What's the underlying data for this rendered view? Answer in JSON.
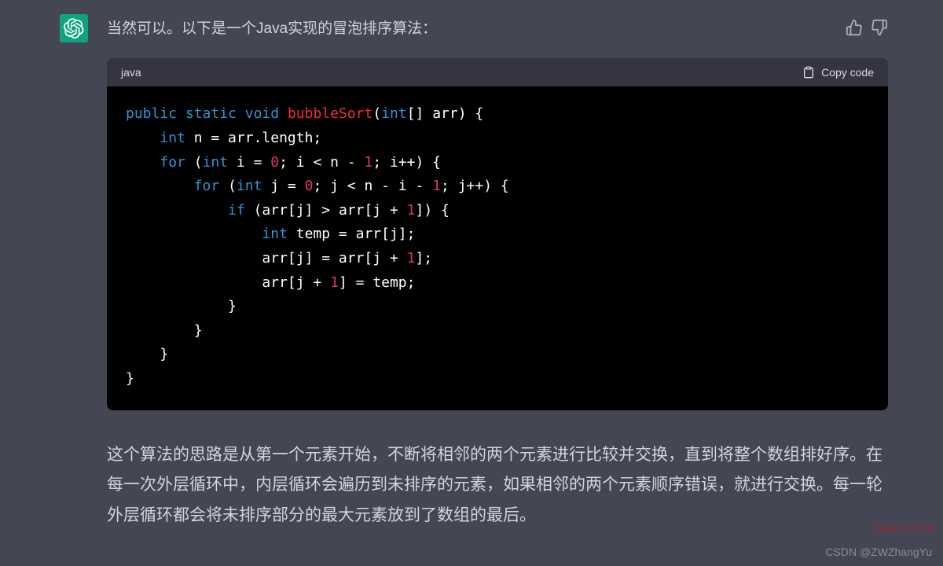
{
  "message": {
    "intro": "当然可以。以下是一个Java实现的冒泡排序算法：",
    "explanation": "这个算法的思路是从第一个元素开始，不断将相邻的两个元素进行比较并交换，直到将整个数组排好序。在每一次外层循环中，内层循环会遍历到未排序的元素，如果相邻的两个元素顺序错误，就进行交换。每一轮外层循环都会将未排序部分的最大元素放到了数组的最后。"
  },
  "code": {
    "language": "java",
    "copy_label": "Copy code",
    "tokens": [
      [
        {
          "t": "public",
          "c": "kw"
        },
        {
          "t": " "
        },
        {
          "t": "static",
          "c": "kw"
        },
        {
          "t": " "
        },
        {
          "t": "void",
          "c": "kw"
        },
        {
          "t": " "
        },
        {
          "t": "bubbleSort",
          "c": "fn"
        },
        {
          "t": "("
        },
        {
          "t": "int",
          "c": "type"
        },
        {
          "t": "[] arr) {"
        }
      ],
      [
        {
          "t": "    "
        },
        {
          "t": "int",
          "c": "type"
        },
        {
          "t": " n = arr.length;"
        }
      ],
      [
        {
          "t": "    "
        },
        {
          "t": "for",
          "c": "kw"
        },
        {
          "t": " ("
        },
        {
          "t": "int",
          "c": "type"
        },
        {
          "t": " i = "
        },
        {
          "t": "0",
          "c": "num"
        },
        {
          "t": "; i < n - "
        },
        {
          "t": "1",
          "c": "num"
        },
        {
          "t": "; i++) {"
        }
      ],
      [
        {
          "t": "        "
        },
        {
          "t": "for",
          "c": "kw"
        },
        {
          "t": " ("
        },
        {
          "t": "int",
          "c": "type"
        },
        {
          "t": " j = "
        },
        {
          "t": "0",
          "c": "num"
        },
        {
          "t": "; j < n - i - "
        },
        {
          "t": "1",
          "c": "num"
        },
        {
          "t": "; j++) {"
        }
      ],
      [
        {
          "t": "            "
        },
        {
          "t": "if",
          "c": "kw"
        },
        {
          "t": " (arr[j] > arr[j + "
        },
        {
          "t": "1",
          "c": "num"
        },
        {
          "t": "]) {"
        }
      ],
      [
        {
          "t": "                "
        },
        {
          "t": "int",
          "c": "type"
        },
        {
          "t": " temp = arr[j];"
        }
      ],
      [
        {
          "t": "                arr[j] = arr[j + "
        },
        {
          "t": "1",
          "c": "num"
        },
        {
          "t": "];"
        }
      ],
      [
        {
          "t": "                arr[j + "
        },
        {
          "t": "1",
          "c": "num"
        },
        {
          "t": "] = temp;"
        }
      ],
      [
        {
          "t": "            }"
        }
      ],
      [
        {
          "t": "        }"
        }
      ],
      [
        {
          "t": "    }"
        }
      ],
      [
        {
          "t": "}"
        }
      ]
    ]
  },
  "watermarks": {
    "site": "Yuucn.com",
    "author": "CSDN @ZWZhangYu"
  }
}
